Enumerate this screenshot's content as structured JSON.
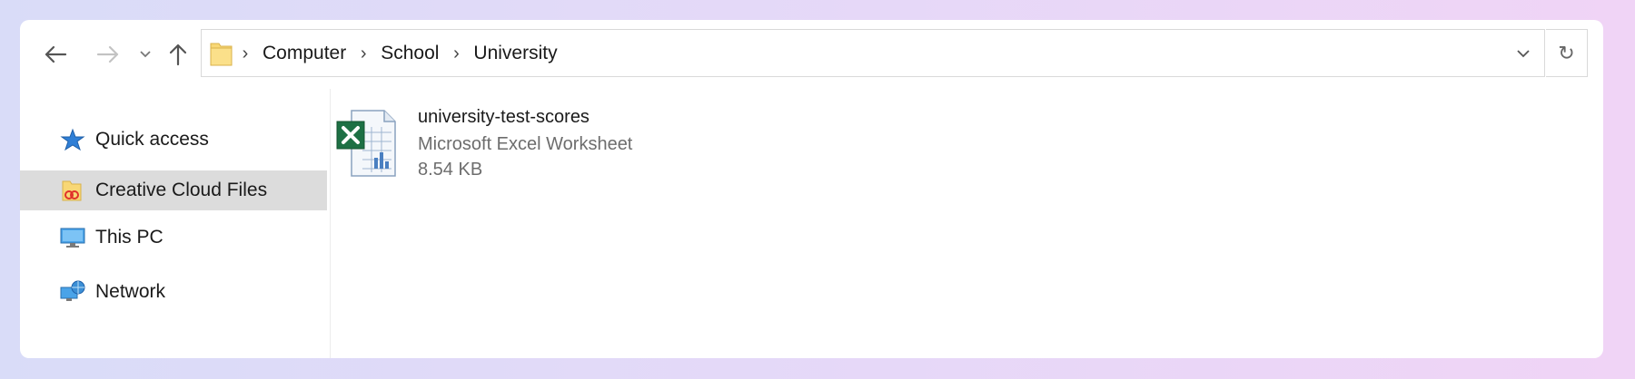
{
  "toolbar": {
    "back_icon": "arrow-left-icon",
    "forward_icon": "arrow-right-icon",
    "recent_icon": "chevron-down-icon",
    "up_icon": "arrow-up-icon",
    "refresh_glyph": "↻"
  },
  "address": {
    "folder_icon": "folder-icon",
    "crumbs": [
      "Computer",
      "School",
      "University"
    ]
  },
  "sidebar": {
    "items": [
      {
        "label": "Quick access",
        "icon": "star-icon"
      },
      {
        "label": "Creative Cloud Files",
        "icon": "creative-cloud-folder-icon",
        "selected": true
      },
      {
        "label": "This PC",
        "icon": "monitor-icon"
      },
      {
        "label": "Network",
        "icon": "network-icon"
      }
    ]
  },
  "files": [
    {
      "name": "university-test-scores",
      "type": "Microsoft Excel Worksheet",
      "size": "8.54 KB",
      "icon": "excel-file-icon"
    }
  ],
  "colors": {
    "selection": "#dcdcdc",
    "folder": "#f8d775",
    "excel_green": "#1d7044"
  }
}
